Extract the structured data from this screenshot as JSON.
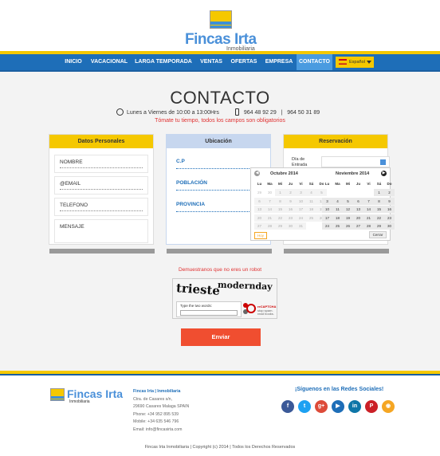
{
  "brand": {
    "name": "Fincas Irta",
    "sub": "Inmobiliaria"
  },
  "nav": {
    "items": [
      "INICIO",
      "VACACIONAL",
      "LARGA TEMPORADA",
      "VENTAS",
      "OFERTAS",
      "EMPRESA",
      "CONTACTO"
    ],
    "active": "CONTACTO",
    "language": "Español"
  },
  "page": {
    "title": "CONTACTO",
    "hours": "Lunes a Viernes de 10:00 a 13:00Hrs",
    "phone1": "964 48 92 29",
    "sep": "|",
    "phone2": "964 50 31 89",
    "note": "Tómate tu tiempo, todos los campos son obligatorios"
  },
  "personal": {
    "header": "Datos Personales",
    "fields": [
      "NOMBRE",
      "@EMAIL",
      "TELEFONO",
      "MENSAJE"
    ]
  },
  "location": {
    "header": "Ubicación",
    "fields": [
      "C.P",
      "POBLACIÓN",
      "PROVINCIA"
    ]
  },
  "reservation": {
    "header": "Reservación",
    "label_line1": "Día de",
    "label_line2": "Entrada"
  },
  "datepicker": {
    "month1": "Octubre 2014",
    "month2": "Noviembre 2014",
    "weekdays": [
      "Lu",
      "Ma",
      "Mi",
      "Ju",
      "Vi",
      "Sá",
      "Do"
    ],
    "today": "Hoy",
    "close": "Cerrar",
    "oct": [
      [
        "29",
        "30",
        "1",
        "2",
        "3",
        "4",
        "5"
      ],
      [
        "6",
        "7",
        "8",
        "9",
        "10",
        "11",
        "12"
      ],
      [
        "13",
        "14",
        "15",
        "16",
        "17",
        "18",
        "19"
      ],
      [
        "20",
        "21",
        "22",
        "23",
        "24",
        "25",
        "26"
      ],
      [
        "27",
        "28",
        "29",
        "30",
        "31",
        "",
        ""
      ]
    ],
    "nov": [
      [
        "",
        "",
        "",
        "",
        "",
        "1",
        "2"
      ],
      [
        "3",
        "4",
        "5",
        "6",
        "7",
        "8",
        "9"
      ],
      [
        "10",
        "11",
        "12",
        "13",
        "14",
        "15",
        "16"
      ],
      [
        "17",
        "18",
        "19",
        "20",
        "21",
        "22",
        "23"
      ],
      [
        "24",
        "25",
        "26",
        "27",
        "28",
        "29",
        "30"
      ]
    ]
  },
  "captcha": {
    "prompt": "Demuestranos que no eres un robot",
    "word1": "trieste",
    "word2": "modernday",
    "input_label": "Type the two words:",
    "logo": "reCAPTCHA",
    "logo_sub1": "stop spam.",
    "logo_sub2": "read books."
  },
  "form": {
    "submit": "Enviar"
  },
  "footer": {
    "company": "Fincas Irta | Inmobiliaria",
    "lines": [
      "Ctra. de Casares s/n,",
      "29690 Casares Malaga SPAIN",
      "Phone: +34 952 895 539",
      "Mobile: +34 635 546 796",
      "Email: info@fincasirta.com"
    ],
    "social_title": "¡Síguenos en las Redes Sociales!",
    "social": [
      {
        "name": "facebook",
        "glyph": "f",
        "color": "#3b5998"
      },
      {
        "name": "twitter",
        "glyph": "t",
        "color": "#1da1f2"
      },
      {
        "name": "google-plus",
        "glyph": "g+",
        "color": "#dd4b39"
      },
      {
        "name": "youtube",
        "glyph": "▶",
        "color": "#1e6eb8"
      },
      {
        "name": "linkedin",
        "glyph": "in",
        "color": "#0e76a8"
      },
      {
        "name": "pinterest",
        "glyph": "P",
        "color": "#cb2027"
      },
      {
        "name": "rss",
        "glyph": "◉",
        "color": "#f5a623"
      }
    ],
    "copyright": "Fincas Irta Inmobiliaria | Copyright (c) 2014 | Todos los Derechos Reservados"
  },
  "colors": {
    "yellow": "#f5c800",
    "blue": "#1e6eb8",
    "active": "#4a9be0",
    "red": "#e03030",
    "button": "#f04e30"
  }
}
